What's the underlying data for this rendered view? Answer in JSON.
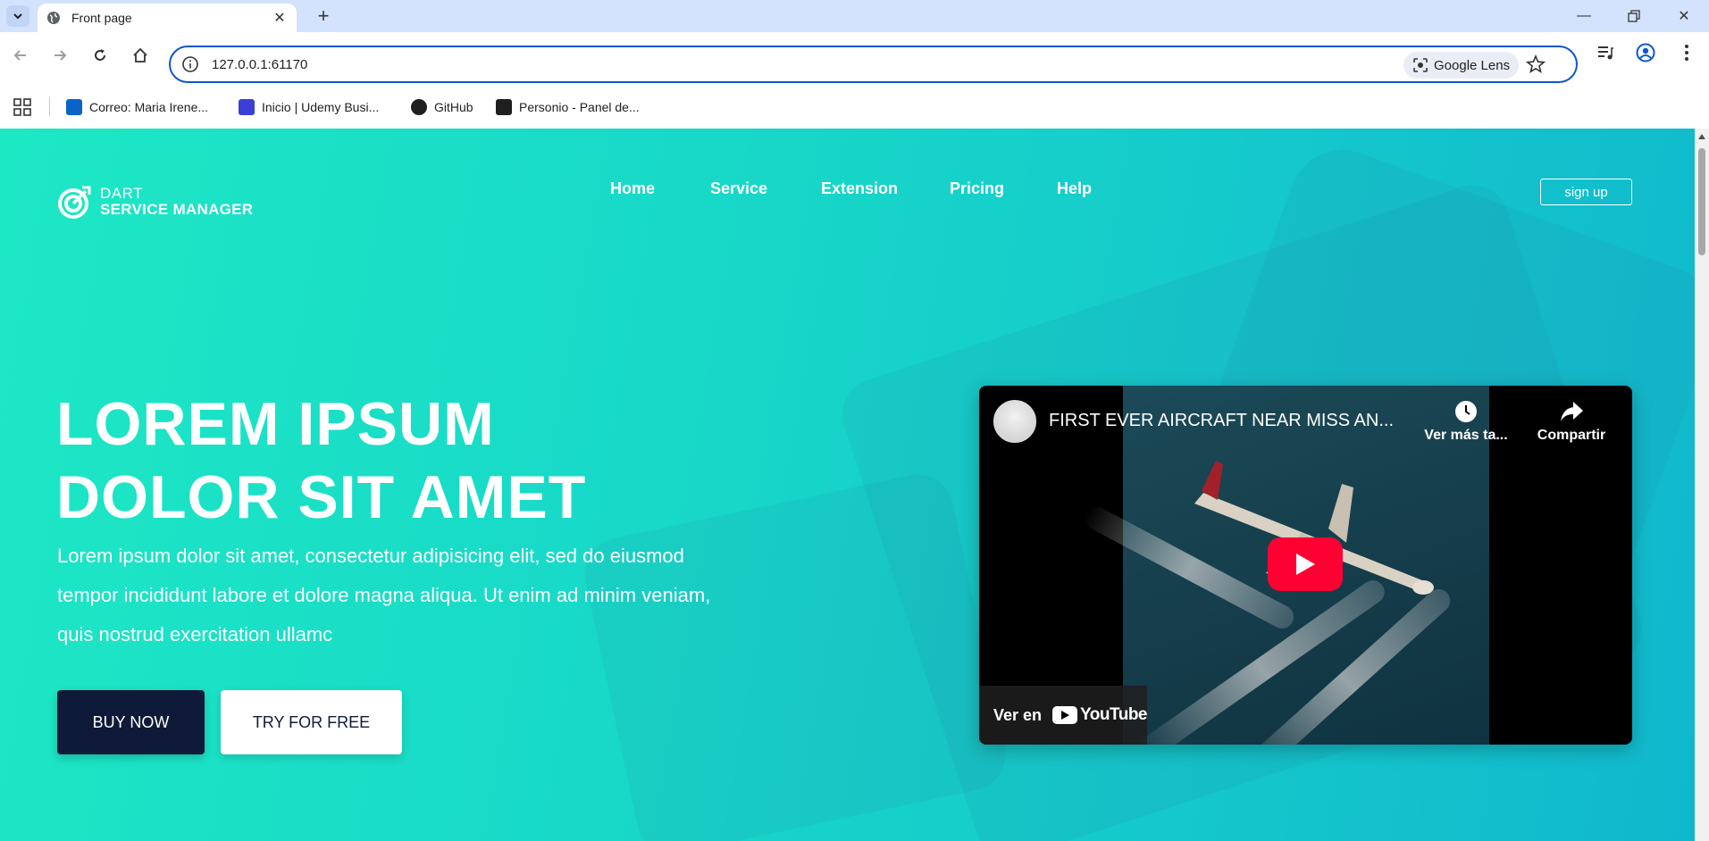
{
  "browser": {
    "tab_title": "Front page",
    "url": "127.0.0.1:61170",
    "lens_label": "Google Lens",
    "bookmarks": [
      {
        "label": "Correo: Maria Irene..."
      },
      {
        "label": "Inicio | Udemy Busi..."
      },
      {
        "label": "GitHub"
      },
      {
        "label": "Personio - Panel de..."
      }
    ]
  },
  "site": {
    "logo_line1": "DART",
    "logo_line2": "SERVICE MANAGER",
    "nav": [
      "Home",
      "Service",
      "Extension",
      "Pricing",
      "Help"
    ],
    "signup_label": "sign up"
  },
  "hero": {
    "title_line1": "LOREM IPSUM",
    "title_line2": "DOLOR SIT AMET",
    "text": "Lorem ipsum dolor sit amet, consectetur adipisicing elit, sed do eiusmod tempor incididunt labore et dolore magna aliqua. Ut enim ad minim veniam, quis nostrud exercitation ullamc",
    "buy_label": "BUY NOW",
    "try_label": "TRY FOR FREE"
  },
  "video": {
    "title": "FIRST EVER AIRCRAFT NEAR MISS AN...",
    "watch_later": "Ver más ta...",
    "share": "Compartir",
    "watch_on": "Ver en",
    "youtube": "YouTube"
  },
  "colors": {
    "accent": "#0b57d0",
    "hero_from": "#1de8c4",
    "hero_to": "#10b8cc",
    "buy_button": "#0e1a38",
    "youtube_red": "#ff0033"
  }
}
